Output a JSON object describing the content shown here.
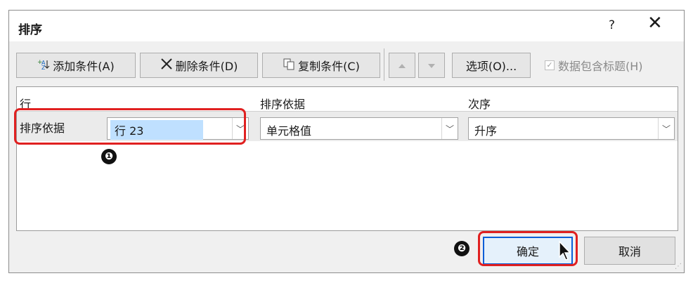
{
  "dialog": {
    "title": "排序",
    "help_label": "?",
    "close_label": "✕"
  },
  "toolbar": {
    "add_label": "添加条件(A)",
    "delete_label": "删除条件(D)",
    "copy_label": "复制条件(C)",
    "options_label": "选项(O)...",
    "header_checkbox_label": "数据包含标题(H)",
    "header_checkbox_checked": true
  },
  "grid": {
    "columns": [
      "行",
      "排序依据",
      "次序"
    ],
    "row": {
      "label": "排序依据",
      "key": "行 23",
      "sort_on": "单元格值",
      "order": "升序"
    }
  },
  "annotations": {
    "marker1": "❶",
    "marker2": "❷",
    "highlight_color": "#e02020"
  },
  "buttons": {
    "ok_label": "确定",
    "cancel_label": "取消"
  },
  "icons": [
    "add-level-icon",
    "delete-x-icon",
    "copy-icon",
    "move-up-icon",
    "move-down-icon",
    "mouse-cursor-icon"
  ]
}
